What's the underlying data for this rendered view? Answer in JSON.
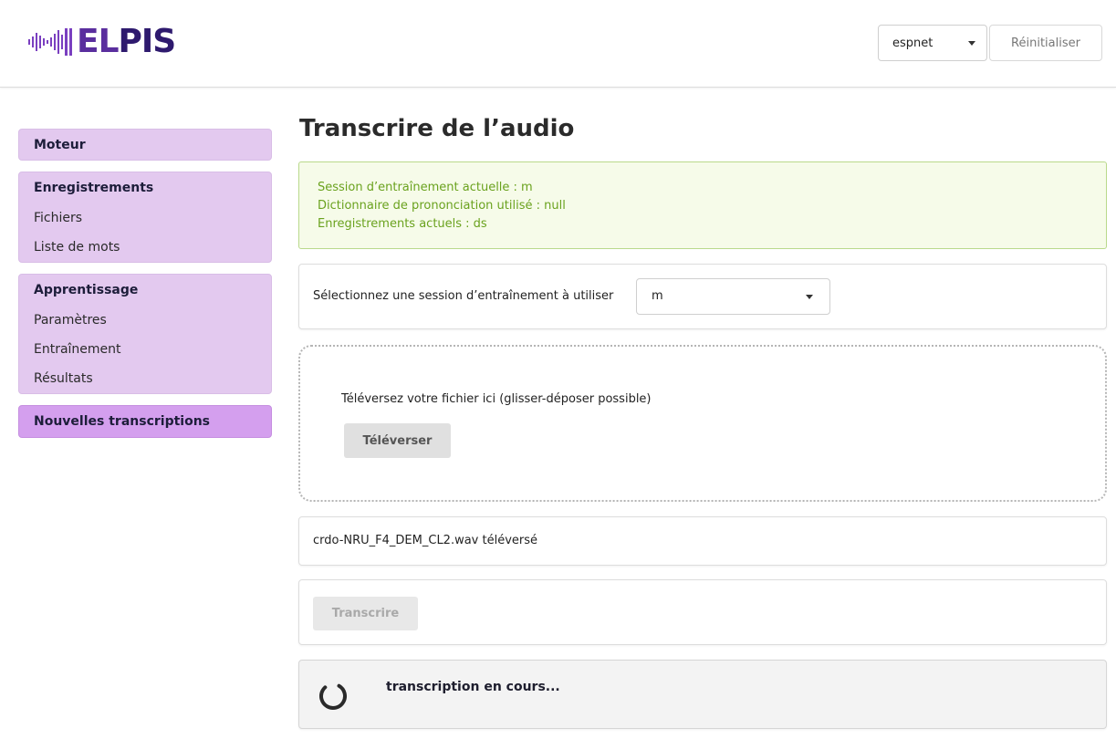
{
  "header": {
    "logo_text_el": "EL",
    "logo_text_pis": "PIS",
    "engine_select_value": "espnet",
    "reset_label": "Réinitialiser"
  },
  "sidebar": {
    "groups": [
      {
        "heading": "Moteur",
        "items": []
      },
      {
        "heading": "Enregistrements",
        "items": [
          "Fichiers",
          "Liste de mots"
        ]
      },
      {
        "heading": "Apprentissage",
        "items": [
          "Paramètres",
          "Entraînement",
          "Résultats"
        ]
      },
      {
        "heading": "Nouvelles transcriptions",
        "items": [],
        "active": true
      }
    ]
  },
  "main": {
    "title": "Transcrire de l’audio",
    "info": {
      "line1": "Session d’entraînement actuelle : m",
      "line2": "Dictionnaire de prononciation utilisé : null",
      "line3": "Enregistrements actuels : ds"
    },
    "session": {
      "label": "Sélectionnez une session d’entraînement à utiliser",
      "selected": "m"
    },
    "dropzone": {
      "text": "Téléversez votre fichier ici (glisser-déposer possible)",
      "button": "Téléverser"
    },
    "uploaded_text": "crdo-NRU_F4_DEM_CL2.wav téléversé",
    "transcribe_button": "Transcrire",
    "progress_text": "transcription en cours..."
  },
  "colors": {
    "sidebar_group_bg": "#e3c9ef",
    "sidebar_active_bg": "#d49fee",
    "info_border": "#b9d98b",
    "info_text": "#6aa21e",
    "logo_purple": "#4a2a8a"
  },
  "icons": {
    "logo_mark": "audio-waveform-icon",
    "select_caret": "caret-down-icon",
    "spinner": "loading-spinner-icon"
  }
}
